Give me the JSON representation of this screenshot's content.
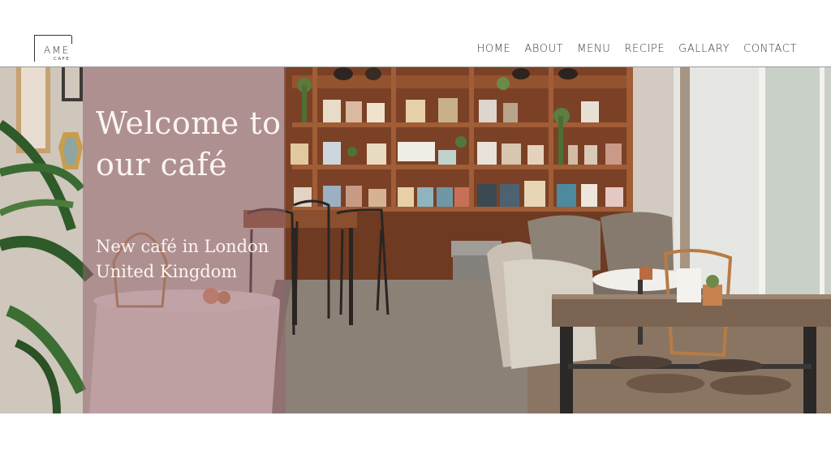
{
  "logo": {
    "name": "AME",
    "subtitle": "CAFE"
  },
  "nav": {
    "items": [
      "HOME",
      "ABOUT",
      "MENU",
      "RECIPE",
      "GALLARY",
      "CONTACT"
    ]
  },
  "hero": {
    "title": "Welcome to our café",
    "subtitle": "New café in London United Kingdom"
  },
  "colors": {
    "overlay": "#96646e",
    "wood": "#8a4b2c",
    "floor": "#7a6a5e"
  }
}
